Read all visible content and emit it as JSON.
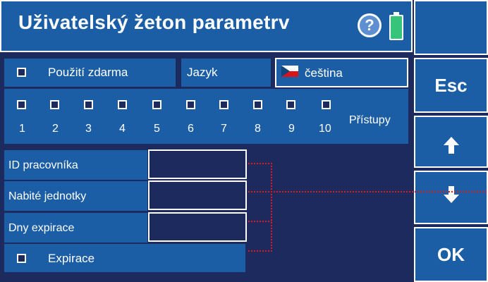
{
  "header": {
    "title": "Uživatelský žeton parametrv",
    "help_glyph": "?"
  },
  "side_buttons": {
    "esc": "Esc",
    "up": "↑",
    "down": "↓",
    "ok": "OK"
  },
  "form": {
    "free_use_label": "Použití zdarma",
    "language_label": "Jazyk",
    "language_value": "čeština",
    "access_label": "Přístupy",
    "access_numbers": [
      "1",
      "2",
      "3",
      "4",
      "5",
      "6",
      "7",
      "8",
      "9",
      "10"
    ],
    "worker_id_label": "ID pracovníka",
    "charged_units_label": "Nabité jednotky",
    "expiry_days_label": "Dny expirace",
    "expiry_label": "Expirace",
    "worker_id_value": "",
    "charged_units_value": "",
    "expiry_days_value": ""
  },
  "icons": {
    "help": "help-icon",
    "battery": "battery-icon",
    "flag": "czech-flag-icon",
    "up": "arrow-up-icon",
    "down": "arrow-down-icon"
  },
  "colors": {
    "background": "#1c2a5e",
    "panel": "#1b5ea6",
    "text": "#ffffff",
    "connector": "#e0191e",
    "battery": "#35c47a"
  }
}
